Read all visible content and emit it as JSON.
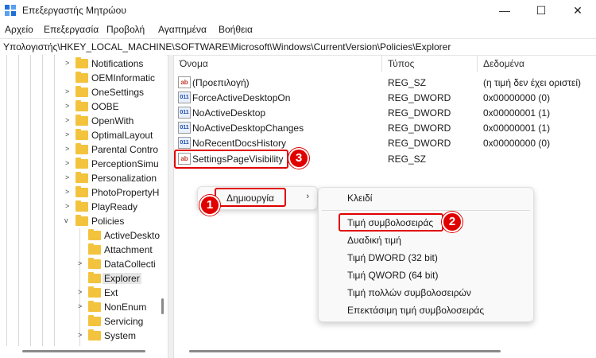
{
  "window": {
    "title": "Επεξεργαστής Μητρώου",
    "minimize": "—",
    "maximize": "☐",
    "close": "✕"
  },
  "menu": [
    "Αρχείο",
    "Επεξεργασία",
    "Προβολή",
    "Αγαπημένα",
    "Βοήθεια"
  ],
  "address": "Υπολογιστής\\HKEY_LOCAL_MACHINE\\SOFTWARE\\Microsoft\\Windows\\CurrentVersion\\Policies\\Explorer",
  "tree": [
    {
      "label": "Notifications"
    },
    {
      "label": "OEMInformatic"
    },
    {
      "label": "OneSettings"
    },
    {
      "label": "OOBE"
    },
    {
      "label": "OpenWith"
    },
    {
      "label": "OptimalLayout"
    },
    {
      "label": "Parental Contro"
    },
    {
      "label": "PerceptionSimu"
    },
    {
      "label": "Personalization"
    },
    {
      "label": "PhotoPropertyH"
    },
    {
      "label": "PlayReady"
    },
    {
      "label": "Policies"
    },
    {
      "label": "ActiveDeskto"
    },
    {
      "label": "Attachment"
    },
    {
      "label": "DataCollecti"
    },
    {
      "label": "Explorer"
    },
    {
      "label": "Ext"
    },
    {
      "label": "NonEnum"
    },
    {
      "label": "Servicing"
    },
    {
      "label": "System"
    }
  ],
  "columns": {
    "name": "Όνομα",
    "type": "Τύπος",
    "data": "Δεδομένα"
  },
  "rows": [
    {
      "name": "(Προεπιλογή)",
      "type": "REG_SZ",
      "data": "(η τιμή δεν έχει οριστεί)",
      "icon": "ab"
    },
    {
      "name": "ForceActiveDesktopOn",
      "type": "REG_DWORD",
      "data": "0x00000000 (0)",
      "icon": "011"
    },
    {
      "name": "NoActiveDesktop",
      "type": "REG_DWORD",
      "data": "0x00000001 (1)",
      "icon": "011"
    },
    {
      "name": "NoActiveDesktopChanges",
      "type": "REG_DWORD",
      "data": "0x00000001 (1)",
      "icon": "011"
    },
    {
      "name": "NoRecentDocsHistory",
      "type": "REG_DWORD",
      "data": "0x00000000 (0)",
      "icon": "011"
    },
    {
      "name": "SettingsPageVisibility",
      "type": "REG_SZ",
      "data": "",
      "icon": "ab"
    }
  ],
  "context_menu": {
    "new_label": "Δημιουργία",
    "arrow": "›"
  },
  "submenu": {
    "key": "Κλειδί",
    "string_value": "Τιμή συμβολοσειράς",
    "binary_value": "Δυαδική τιμή",
    "dword_value": "Τιμή DWORD (32 bit)",
    "qword_value": "Τιμή QWORD (64 bit)",
    "multi_string_value": "Τιμή πολλών συμβολοσειρών",
    "expandable_string_value": "Επεκτάσιμη τιμή συμβολοσειράς"
  },
  "markers": {
    "m1": "1",
    "m2": "2",
    "m3": "3"
  },
  "colors": {
    "annotation": "#e00000",
    "folder": "#f3c33e"
  }
}
